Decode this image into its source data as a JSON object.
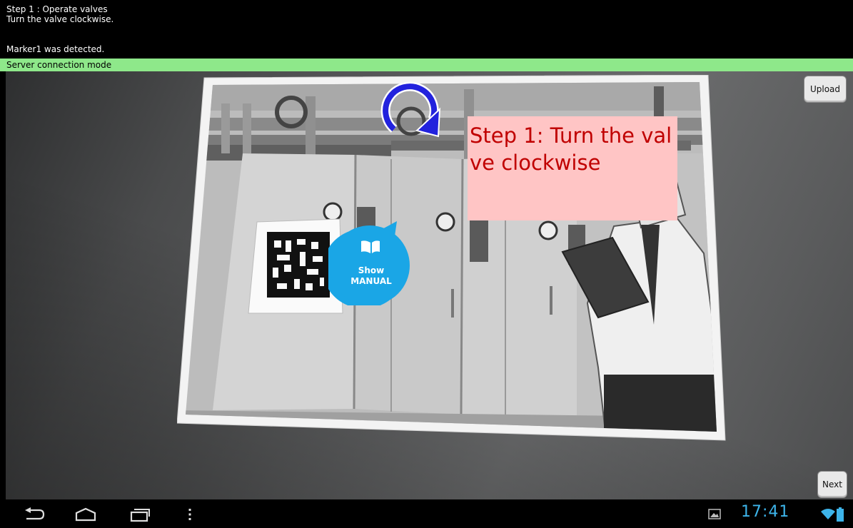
{
  "info": {
    "step_line": "Step 1 : Operate valves",
    "instruction_line": "Turn the valve clockwise.",
    "marker_line": "Marker1 was detected."
  },
  "mode_bar": {
    "label": "Server connection mode"
  },
  "buttons": {
    "upload": "Upload",
    "next": "Next"
  },
  "overlay": {
    "step_text": "Step 1: Turn the valve clockwise",
    "manual_line1": "Show",
    "manual_line2": "MANUAL"
  },
  "status_bar": {
    "time": "17:41"
  },
  "icons": {
    "rotate": "clockwise-rotate-arrow-icon",
    "manual": "open-book-icon",
    "back": "back-icon",
    "home": "home-icon",
    "recents": "recent-apps-icon",
    "menu": "menu-icon",
    "gallery": "gallery-icon",
    "wifi": "wifi-icon",
    "battery": "battery-icon"
  },
  "colors": {
    "mode_bar": "#8ee88a",
    "step_box_bg": "#ffc5c5",
    "step_text": "#c00000",
    "manual_bubble": "#1aa6e6",
    "rotate_arrow": "#2222dd",
    "clock": "#3db4ea"
  }
}
